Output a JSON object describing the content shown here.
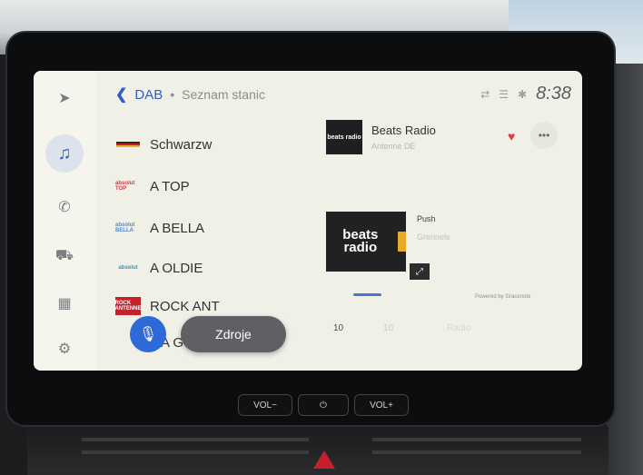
{
  "header": {
    "back_icon": "chevron-left-icon",
    "source": "DAB",
    "separator": "•",
    "breadcrumb": "Seznam stanic",
    "time": "8:38"
  },
  "sidebar": {
    "items": [
      {
        "icon": "navigation-arrow-icon",
        "active": false
      },
      {
        "icon": "music-note-icon",
        "active": true
      },
      {
        "icon": "phone-icon",
        "active": false
      },
      {
        "icon": "car-icon",
        "active": false
      },
      {
        "icon": "apps-grid-icon",
        "active": false
      },
      {
        "icon": "gear-icon",
        "active": false
      }
    ]
  },
  "stations": [
    {
      "name": "Schwarzw",
      "logo": ""
    },
    {
      "name": "A TOP",
      "logo": "absolut TOP"
    },
    {
      "name": "A BELLA",
      "logo": "absolut BELLA"
    },
    {
      "name": "A OLDIE",
      "logo": "absolut"
    },
    {
      "name": "ROCK ANT",
      "logo": "ROCK ANTENNE"
    },
    {
      "name": "A G",
      "logo": ""
    }
  ],
  "now_playing": {
    "station": "Beats Radio",
    "provider": "Antenne DE",
    "art_text": "beats radio",
    "track": "Push",
    "artist": "Grennels",
    "powered_by": "Powered by Gracenote"
  },
  "presets": [
    "10",
    "10",
    "Radio"
  ],
  "controls": {
    "sources_label": "Zdroje"
  },
  "hardware": {
    "vol_down": "VOL−",
    "power": "⏻",
    "vol_up": "VOL+"
  },
  "colors": {
    "accent": "#2e5fc9",
    "heart": "#e0404b",
    "screen_bg": "#f1f0e7"
  }
}
